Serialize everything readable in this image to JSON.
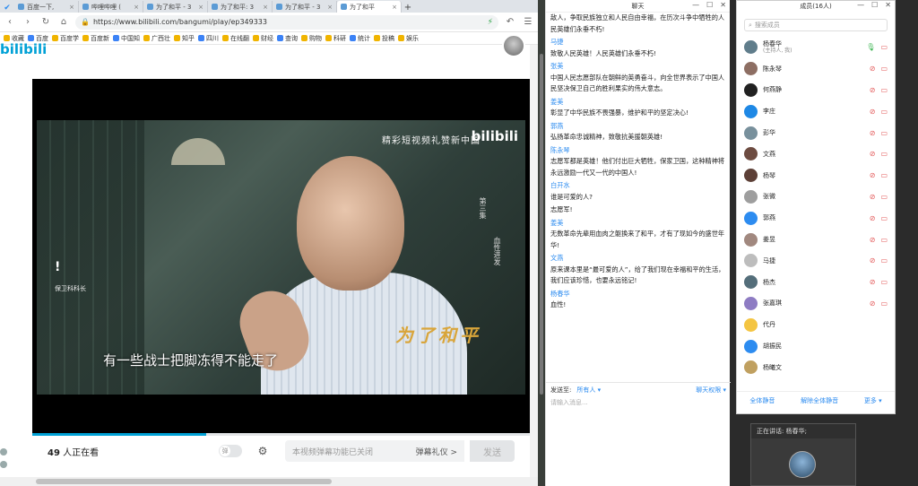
{
  "browser": {
    "tabs": [
      {
        "label": "百度一下,"
      },
      {
        "label": "哔哩哔哩 ("
      },
      {
        "label": "为了和平 - 3"
      },
      {
        "label": "为了和平: 3"
      },
      {
        "label": "为了和平 - 3"
      },
      {
        "label": "为了和平"
      }
    ],
    "url": "https://www.bilibili.com/bangumi/play/ep349333",
    "bookmarks": [
      "收藏",
      "百度",
      "百度学",
      "百度新",
      "中国知",
      "广西壮",
      "知乎",
      "四川",
      "在线翻",
      "财经",
      "查询",
      "购物",
      "科研",
      "统计",
      "投稿",
      "娱乐"
    ],
    "logo": "bilibili"
  },
  "video": {
    "overlay_title": "精彩短视频礼赞新中国",
    "overlay_logo": "bilibili",
    "episode": "第三集",
    "episode_title": "血性进发",
    "left_caption": "保卫科科长",
    "calligraphy": "为了和平",
    "subtitle": "有一些战士把脚冻得不能走了",
    "progress": 0.35
  },
  "player_bar": {
    "viewers_count": "49",
    "viewers_suffix": " 人正在看",
    "danmaku_placeholder": "本视频弹幕功能已关闭",
    "etiquette": "弹幕礼仪 >",
    "send": "发送"
  },
  "chat": {
    "title": "聊天",
    "messages": [
      {
        "name": "",
        "text": "敌人，争取民族独立和人民自由幸福，在历次斗争中牺牲的人民英雄们永垂不朽!"
      },
      {
        "name": "马捷",
        "text": "致敬人民英雄！人民英雄们永垂不朽!"
      },
      {
        "name": "张美",
        "text": "中国人民志愿部队在朝鲜的英勇奋斗，向全世界表示了中国人民坚决保卫自己的胜利果实的伟大意志。"
      },
      {
        "name": "姜美",
        "text": "彰显了中华民族不畏强暴，维护和平的坚定决心!"
      },
      {
        "name": "郭燕",
        "text": "弘扬革命忠诚精神，致敬抗美援朝英雄!"
      },
      {
        "name": "陈永琴",
        "text": "志愿军都是英雄！他们付出巨大牺牲，保家卫国，这种精神将永远激励一代又一代的中国人!"
      },
      {
        "name": "白开水",
        "text": "谁是可爱的人?"
      },
      {
        "name": "",
        "text": "志愿军!"
      },
      {
        "name": "姜美",
        "text": "无数革命先辈用血肉之躯换来了和平，才有了现如今的盛世年华!"
      },
      {
        "name": "文燕",
        "text": "原来课本里是“最可爱的人”，给了我们现在幸福和平的生活，我们应该珍惜，也要永远铭记!"
      },
      {
        "name": "杨春华",
        "text": "血性!"
      }
    ],
    "send_to_label": "发送至:",
    "send_to_value": "所有人 ▾",
    "permission": "聊天权限 ▾",
    "input_placeholder": "请输入消息..."
  },
  "members": {
    "title": "成员(16人)",
    "search_placeholder": "搜索成员",
    "list": [
      {
        "name": "杨春华",
        "sub": "(主持人, 我)",
        "color": "#607d8b",
        "mic": "on"
      },
      {
        "name": "陈永琴",
        "sub": "",
        "color": "#8d6e63",
        "mic": "off"
      },
      {
        "name": "何燕静",
        "sub": "",
        "color": "#212121",
        "mic": "off"
      },
      {
        "name": "李庄",
        "sub": "",
        "color": "#1e88e5",
        "mic": "off"
      },
      {
        "name": "彭华",
        "sub": "",
        "color": "#78909c",
        "mic": "off"
      },
      {
        "name": "文燕",
        "sub": "",
        "color": "#6d4c41",
        "mic": "off"
      },
      {
        "name": "杨琴",
        "sub": "",
        "color": "#5d4037",
        "mic": "off"
      },
      {
        "name": "张微",
        "sub": "",
        "color": "#9e9e9e",
        "mic": "off"
      },
      {
        "name": "郭燕",
        "sub": "",
        "color": "#2d8cf0",
        "mic": "off"
      },
      {
        "name": "姜昱",
        "sub": "",
        "color": "#a1887f",
        "mic": "off"
      },
      {
        "name": "马捷",
        "sub": "",
        "color": "#bdbdbd",
        "mic": "off"
      },
      {
        "name": "杨杰",
        "sub": "",
        "color": "#546e7a",
        "mic": "off"
      },
      {
        "name": "张嘉琪",
        "sub": "",
        "color": "#8e7cc3",
        "mic": "off"
      },
      {
        "name": "代丹",
        "sub": "",
        "color": "#f4c542",
        "mic": ""
      },
      {
        "name": "胡振民",
        "sub": "",
        "color": "#2d8cf0",
        "mic": ""
      },
      {
        "name": "杨曦文",
        "sub": "",
        "color": "#c0a060",
        "mic": ""
      }
    ],
    "mute_all": "全体静音",
    "unmute_all": "解除全体静音",
    "more": "更多 ▾"
  },
  "speaker": {
    "label": "正在讲话: 杨春华;"
  }
}
